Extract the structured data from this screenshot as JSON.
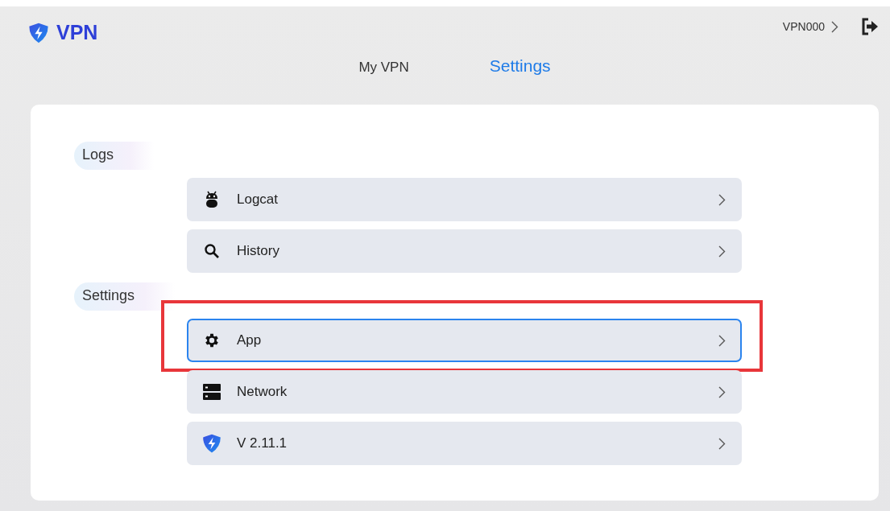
{
  "header": {
    "logo_text": "VPN",
    "account": "VPN000"
  },
  "tabs": [
    {
      "label": "My VPN",
      "selected": false
    },
    {
      "label": "Settings",
      "selected": true
    }
  ],
  "sections": [
    {
      "title": "Logs",
      "items": [
        {
          "label": "Logcat",
          "focused": false,
          "highlighted": false
        },
        {
          "label": "History",
          "focused": false,
          "highlighted": false
        }
      ]
    },
    {
      "title": "Settings",
      "items": [
        {
          "label": "App",
          "focused": true,
          "highlighted": true
        },
        {
          "label": "Network",
          "focused": false,
          "highlighted": false
        },
        {
          "label": "V 2.11.1",
          "focused": false,
          "highlighted": false
        }
      ]
    }
  ]
}
